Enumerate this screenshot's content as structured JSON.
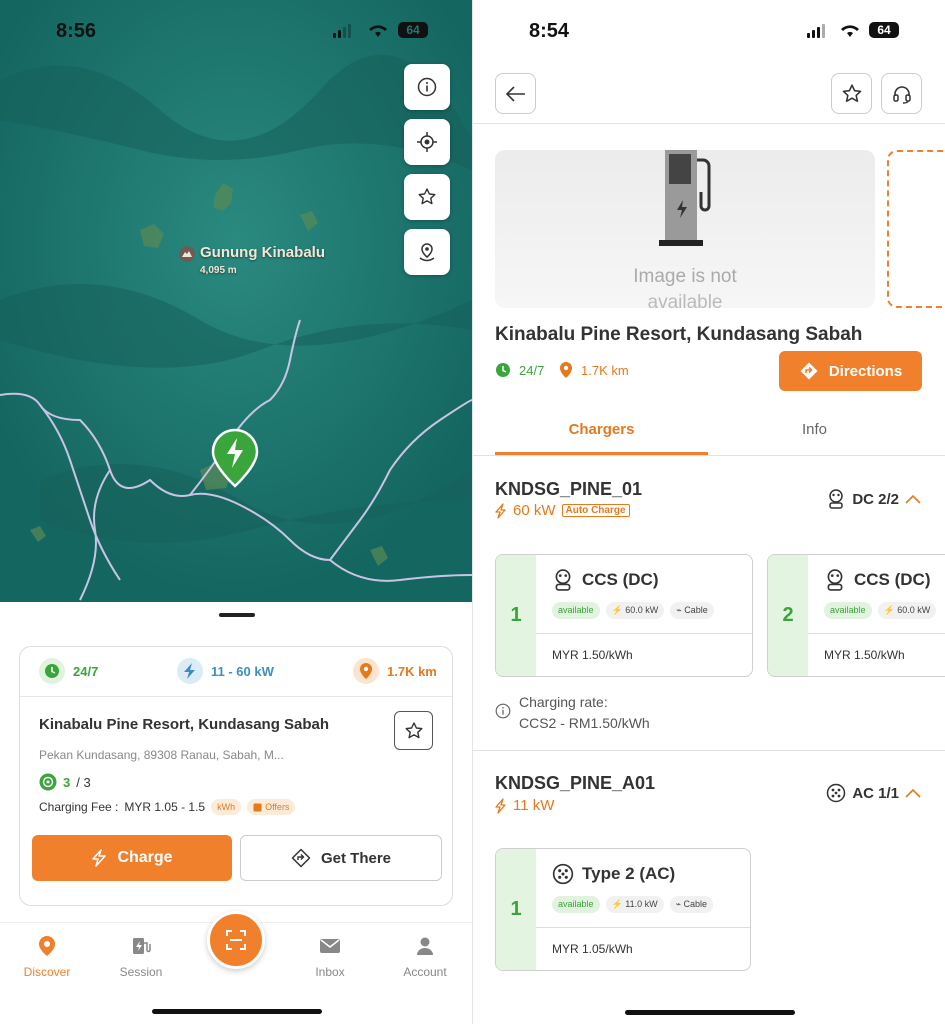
{
  "left": {
    "status": {
      "time": "8:56",
      "battery": "64"
    },
    "map": {
      "peak_name": "Gunung Kinabalu",
      "peak_elev": "4,095 m"
    },
    "card": {
      "hours": "24/7",
      "power_range": "11 - 60 kW",
      "distance": "1.7K km",
      "title": "Kinabalu Pine Resort, Kundasang Sabah",
      "address": "Pekan Kundasang, 89308 Ranau, Sabah, M...",
      "availability": "3",
      "availability_total": "/ 3",
      "fee_label": "Charging Fee :",
      "fee_value": "MYR 1.05 - 1.5",
      "fee_unit": "kWh",
      "offers": "Offers",
      "charge_label": "Charge",
      "get_there_label": "Get There"
    },
    "tabbar": {
      "discover": "Discover",
      "session": "Session",
      "inbox": "Inbox",
      "account": "Account"
    }
  },
  "right": {
    "status": {
      "time": "8:54",
      "battery": "64"
    },
    "image_placeholder": {
      "line1": "Image is not",
      "line2": "available"
    },
    "title": "Kinabalu Pine Resort, Kundasang Sabah",
    "hours": "24/7",
    "distance": "1.7K km",
    "directions_label": "Directions",
    "tabs": {
      "chargers": "Chargers",
      "info": "Info"
    },
    "groups": [
      {
        "name": "KNDSG_PINE_01",
        "power": "60 kW",
        "auto_badge": "Auto Charge",
        "type": "DC 2/2"
      },
      {
        "name": "KNDSG_PINE_A01",
        "power": "11 kW",
        "type": "AC 1/1"
      }
    ],
    "connectors": [
      {
        "index": "1",
        "name": "CCS (DC)",
        "status": "available",
        "power": "60.0 kW",
        "cable": "Cable",
        "price": "MYR 1.50/kWh"
      },
      {
        "index": "2",
        "name": "CCS (DC)",
        "status": "available",
        "power": "60.0 kW",
        "cable": "Cable",
        "price": "MYR 1.50/kWh"
      },
      {
        "index": "1",
        "name": "Type 2 (AC)",
        "status": "available",
        "power": "11.0 kW",
        "cable": "Cable",
        "price": "MYR 1.05/kWh"
      }
    ],
    "rate": {
      "label": "Charging rate:",
      "value": "CCS2 - RM1.50/kWh"
    }
  },
  "colors": {
    "accent": "#f0802b",
    "green": "#3aa53a",
    "map": "#1e7a72"
  }
}
